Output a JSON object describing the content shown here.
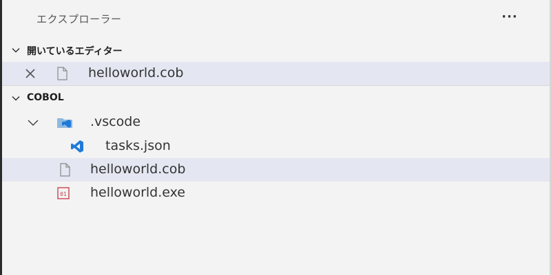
{
  "explorer": {
    "title": "エクスプローラー",
    "more_actions_label": "···"
  },
  "sections": {
    "open_editors": {
      "title": "開いているエディター",
      "files": [
        {
          "name": "helloworld.cob",
          "icon": "file-icon",
          "selected": true
        }
      ]
    },
    "workspace": {
      "title": "COBOL",
      "tree": [
        {
          "name": ".vscode",
          "icon": "vscode-folder-icon",
          "expanded": true
        },
        {
          "name": "tasks.json",
          "icon": "vscode-logo-icon"
        },
        {
          "name": "helloworld.cob",
          "icon": "file-icon",
          "selected": true
        },
        {
          "name": "helloworld.exe",
          "icon": "binary-file-icon"
        }
      ]
    }
  },
  "colors": {
    "background": "#f3f3f3",
    "selection": "#e4e6f1",
    "vscode_blue": "#1f7ad8",
    "binary_red": "#c7444f"
  }
}
